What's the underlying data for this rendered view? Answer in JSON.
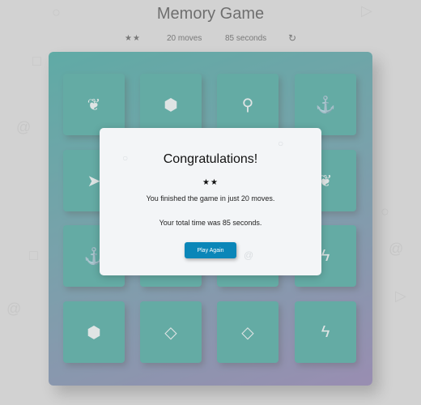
{
  "title": "Memory Game",
  "score_panel": {
    "stars": "★★",
    "moves_text": "20 moves",
    "timer_text": "85 seconds",
    "restart_icon": "↻"
  },
  "cards": [
    {
      "icon": "leaf-icon",
      "glyph": "❦"
    },
    {
      "icon": "cube-icon",
      "glyph": "⬢"
    },
    {
      "icon": "bicycle-icon",
      "glyph": "⚲"
    },
    {
      "icon": "anchor-icon",
      "glyph": "⚓"
    },
    {
      "icon": "paper-plane-icon",
      "glyph": "➤"
    },
    {
      "icon": "hidden",
      "glyph": ""
    },
    {
      "icon": "hidden",
      "glyph": ""
    },
    {
      "icon": "leaf-icon",
      "glyph": "❦"
    },
    {
      "icon": "anchor-icon",
      "glyph": "⚓"
    },
    {
      "icon": "hidden",
      "glyph": ""
    },
    {
      "icon": "hidden",
      "glyph": ""
    },
    {
      "icon": "bolt-icon",
      "glyph": "ϟ"
    },
    {
      "icon": "cube-icon",
      "glyph": "⬢"
    },
    {
      "icon": "diamond-icon",
      "glyph": "◇"
    },
    {
      "icon": "diamond-icon",
      "glyph": "◇"
    },
    {
      "icon": "bolt-icon",
      "glyph": "ϟ"
    }
  ],
  "modal": {
    "title": "Congratulations!",
    "stars": "★★",
    "line1": "You finished the game in just 20 moves.",
    "line2": "Your total time was 85 seconds.",
    "button_label": "Play Again"
  },
  "colors": {
    "card": "#0a8a7f",
    "deck_start": "#028a80",
    "deck_end": "#6a5596",
    "button": "#0a86b8"
  }
}
